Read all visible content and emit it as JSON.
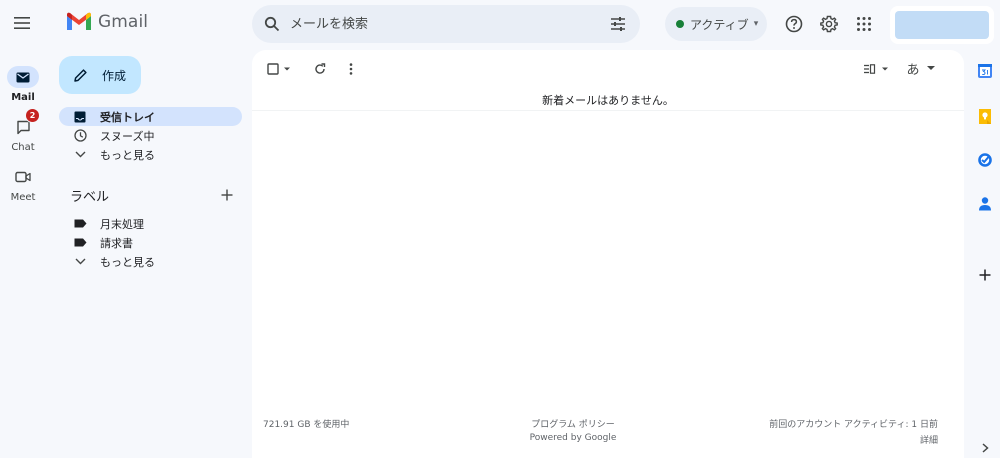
{
  "header": {
    "app_name": "Gmail",
    "search_placeholder": "メールを検索",
    "status_label": "アクティブ",
    "status_color": "#188038"
  },
  "rail": {
    "mail_label": "Mail",
    "chat_label": "Chat",
    "chat_badge": "2",
    "meet_label": "Meet"
  },
  "compose_label": "作成",
  "nav": {
    "inbox": "受信トレイ",
    "snoozed": "スヌーズ中",
    "more": "もっと見る"
  },
  "labels": {
    "heading": "ラベル",
    "items": [
      "月末処理",
      "請求書"
    ],
    "more": "もっと見る"
  },
  "main": {
    "input_tools_label": "あ",
    "empty_message": "新着メールはありません。",
    "footer": {
      "storage": "721.91 GB を使用中",
      "policy": "プログラム ポリシー",
      "powered": "Powered by Google",
      "activity": "前回のアカウント アクティビティ: 1 日前",
      "details": "詳細"
    }
  },
  "colors": {
    "accent": "#0b57d0",
    "badge": "#c5221f",
    "compose_bg": "#c2e7ff",
    "active_nav_bg": "#d3e3fd"
  }
}
